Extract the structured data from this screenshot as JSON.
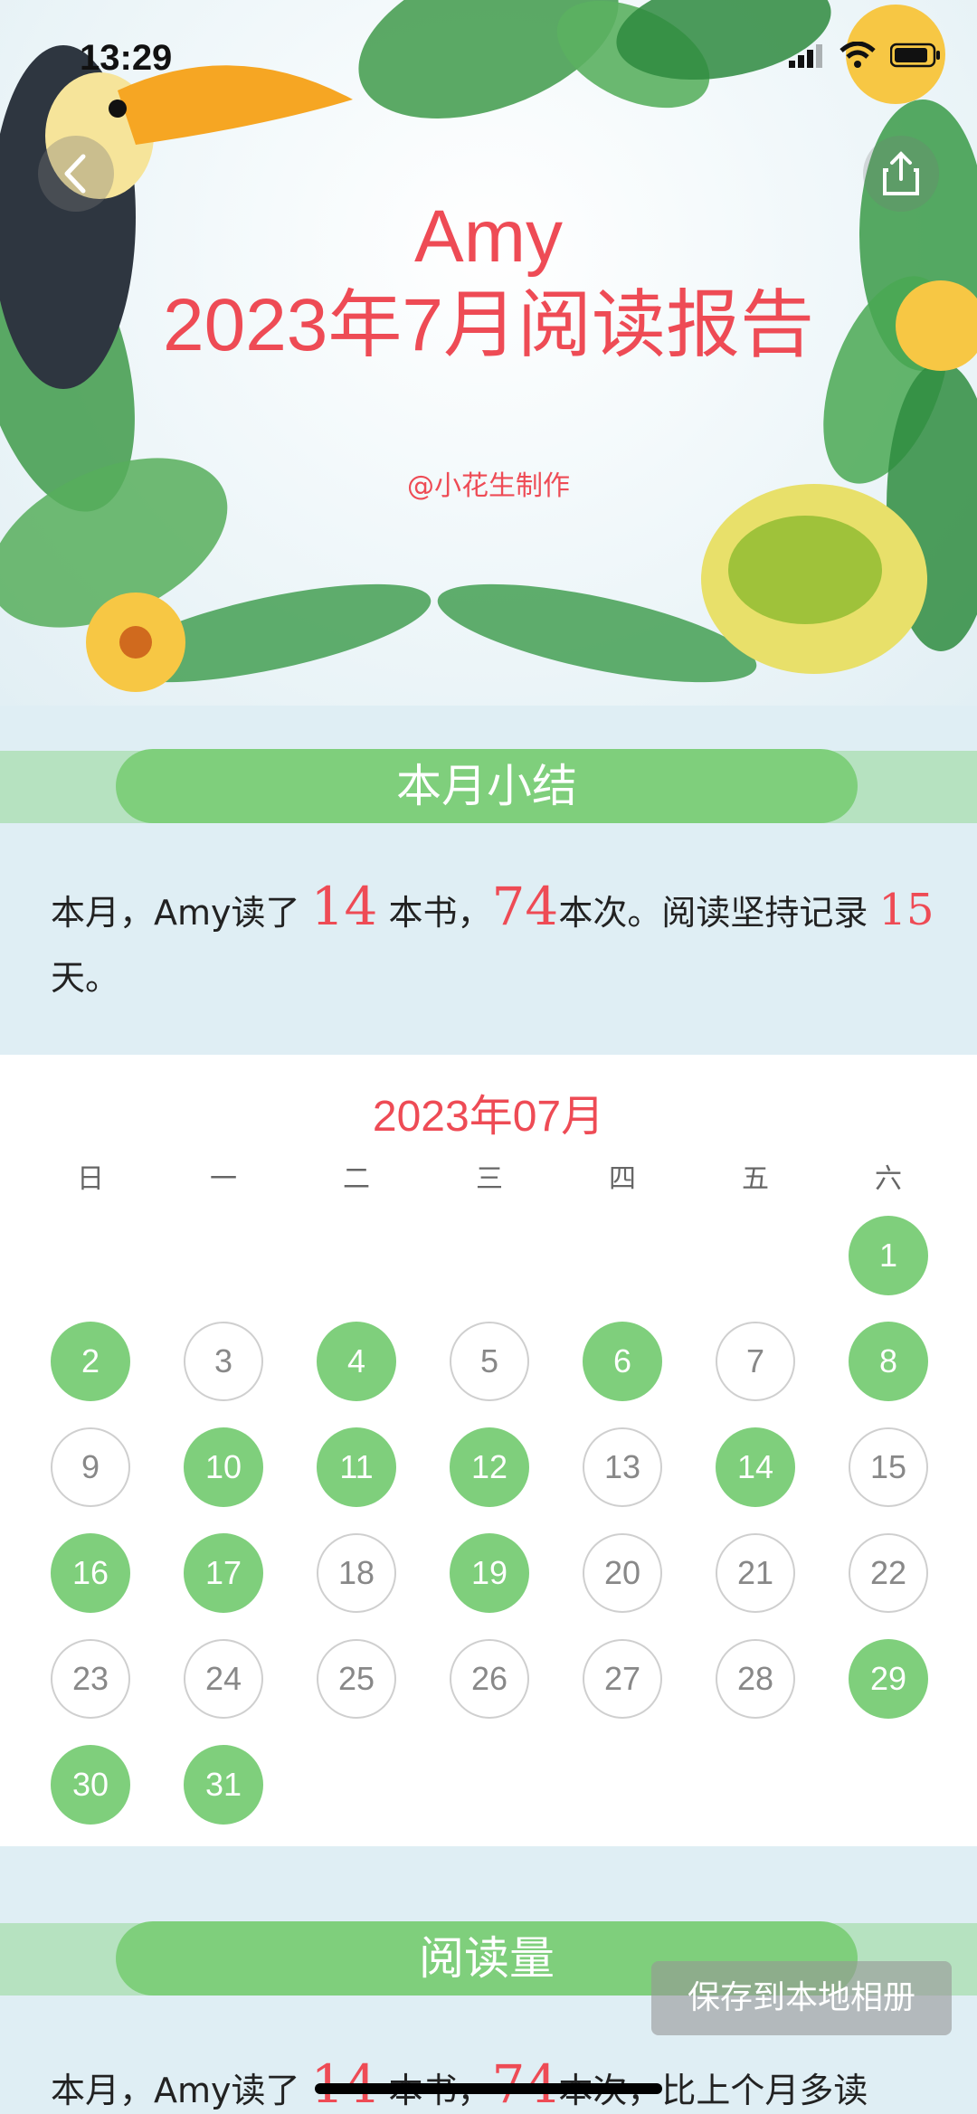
{
  "status_bar": {
    "time": "13:29"
  },
  "header": {
    "name": "Amy",
    "report_title": "2023年7月阅读报告",
    "maker": "@小花生制作",
    "back_icon": "chevron-left-icon",
    "share_icon": "share-icon"
  },
  "section_summary": {
    "title": "本月小结",
    "text_prefix": "本月，Amy读了 ",
    "books": "14",
    "text_mid1": " 本书，",
    "times": "74",
    "text_mid2": "本次。阅读坚持记录 ",
    "days": "15",
    "text_suffix": " 天。"
  },
  "calendar": {
    "title": "2023年07月",
    "weekdays": [
      "日",
      "一",
      "二",
      "三",
      "四",
      "五",
      "六"
    ],
    "first_weekday": 6,
    "days_in_month": 31,
    "read_days": [
      1,
      2,
      4,
      6,
      8,
      10,
      11,
      12,
      14,
      16,
      17,
      19,
      29,
      30,
      31
    ],
    "colors": {
      "read": "#7fcf7c",
      "unread_border": "#cfcfcf",
      "title": "#ee4b55"
    }
  },
  "section_volume": {
    "title": "阅读量",
    "text_prefix": "本月，Amy读了 ",
    "books": "14",
    "text_mid1": " 本书，",
    "times": "74",
    "text_mid2": "本次，比上个月多读"
  },
  "save_button": {
    "label": "保存到本地相册"
  },
  "colors": {
    "accent_red": "#ee4b55",
    "accent_green": "#7fcf7c",
    "banner_strip": "#b6e2c0"
  }
}
